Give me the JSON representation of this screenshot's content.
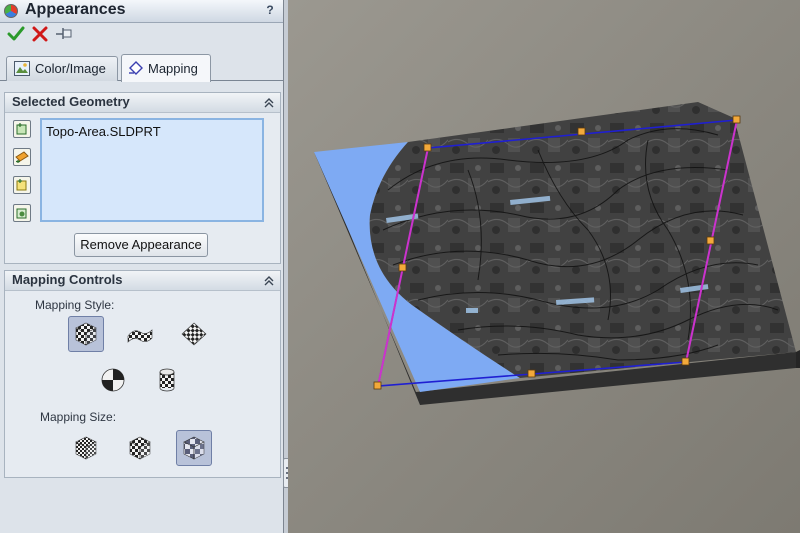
{
  "panel": {
    "title": "Appearances",
    "help": "?",
    "actions": {
      "ok": "check-icon",
      "cancel": "x-icon",
      "pin": "pushpin-icon"
    }
  },
  "tabs": [
    {
      "label": "Color/Image",
      "icon": "image-icon",
      "active": false
    },
    {
      "label": "Mapping",
      "icon": "mapping-icon",
      "active": true
    }
  ],
  "selected_geometry": {
    "title": "Selected Geometry",
    "items": [
      "Topo-Area.SLDPRT"
    ],
    "remove_label": "Remove Appearance"
  },
  "mapping_controls": {
    "title": "Mapping Controls",
    "style_label": "Mapping Style:",
    "styles": [
      "automatic",
      "surface",
      "projection",
      "spherical",
      "cylindrical"
    ],
    "selected_style": "automatic",
    "size_label": "Mapping Size:",
    "sizes": [
      "small",
      "medium",
      "large"
    ],
    "selected_size": "large"
  },
  "colors": {
    "accent_frame": "#1f1fd2",
    "accent_handles": "#cc33cc",
    "selected_face": "#7eaaf3"
  }
}
